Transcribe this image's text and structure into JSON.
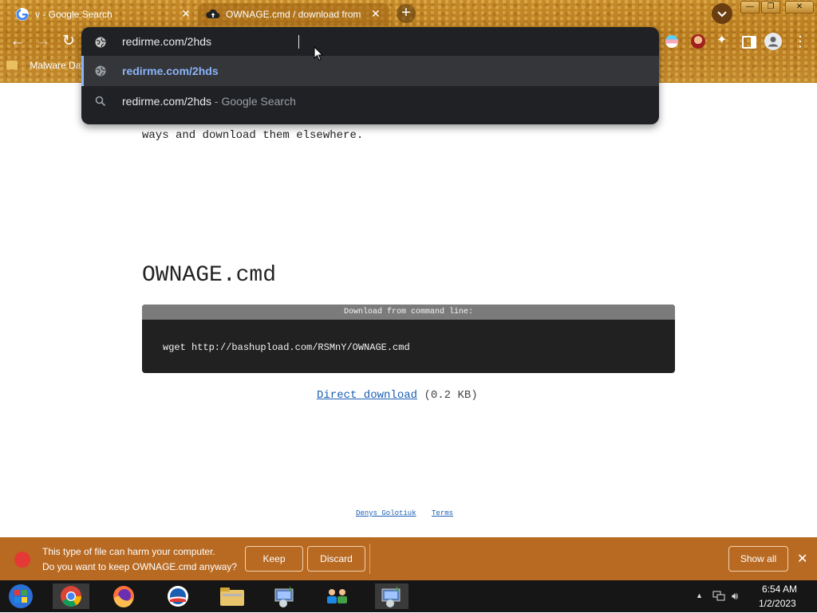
{
  "browser": {
    "tabs": [
      {
        "title": "v - Google Search",
        "active": false
      },
      {
        "title": "OWNAGE.cmd / download from b",
        "active": true
      }
    ],
    "new_tab_symbol": "+",
    "bookmarks_bar": {
      "item_label": "Malware Dat"
    },
    "window_controls": {
      "minimize": "—",
      "restore": "❐",
      "close": "✕"
    },
    "omnibox": {
      "input_value": "redirme.com/2hds",
      "suggestions": [
        {
          "icon": "globe-icon",
          "main": "redirme.com/2hds",
          "secondary": "",
          "highlighted": true
        },
        {
          "icon": "search-icon",
          "main": "redirme.com/2hds",
          "secondary": " - Google Search",
          "highlighted": false
        }
      ]
    },
    "accent_color": "#8ab4f8"
  },
  "page": {
    "intro_line": "ways and download them elsewhere.",
    "file_title": "OWNAGE.cmd",
    "command_header": "Download from command line:",
    "command": "wget http://bashupload.com/RSMnY/OWNAGE.cmd",
    "direct_download_label": "Direct download",
    "file_size": "(0.2 KB)",
    "footer_links": [
      "Denys Golotiuk",
      "Terms"
    ]
  },
  "download_bar": {
    "warning_line1": "This type of file can harm your computer.",
    "warning_line2": "Do you want to keep OWNAGE.cmd anyway?",
    "keep_label": "Keep",
    "discard_label": "Discard",
    "show_all_label": "Show all",
    "close_symbol": "✕",
    "bar_color": "#b86a22"
  },
  "taskbar": {
    "apps": [
      "start-orb-icon",
      "chrome-icon",
      "firefox-icon",
      "obama-logo-icon",
      "folder-icon",
      "installer-icon",
      "network-people-icon",
      "installer-icon"
    ],
    "clock_time": "6:54 AM",
    "clock_date": "1/2/2023",
    "tray_chevron": "▲"
  }
}
